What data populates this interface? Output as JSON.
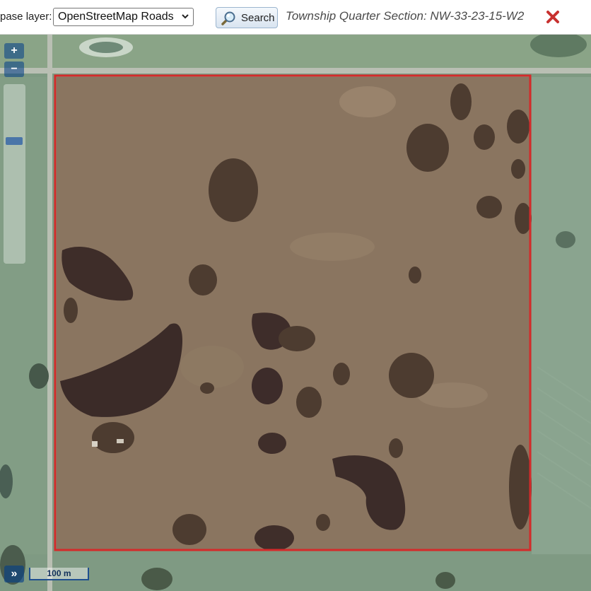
{
  "toolbar": {
    "base_layer_label": "pase layer:",
    "base_layer_value": "OpenStreetMap Roads",
    "search_label": "Search",
    "quarter_section_text": "Township Quarter Section: NW-33-23-15-W2"
  },
  "map": {
    "zoom_in": "+",
    "zoom_out": "−",
    "layer_toggle": "»",
    "scale_label": "100 m",
    "zoom_level_fraction": 0.3,
    "parcel_outline_color": "#d42a2a",
    "imagery_colors": {
      "field": "#8a7560",
      "crop": "#7d9a80",
      "water": "#3a2a28",
      "trees": "#4b3a2e"
    }
  }
}
